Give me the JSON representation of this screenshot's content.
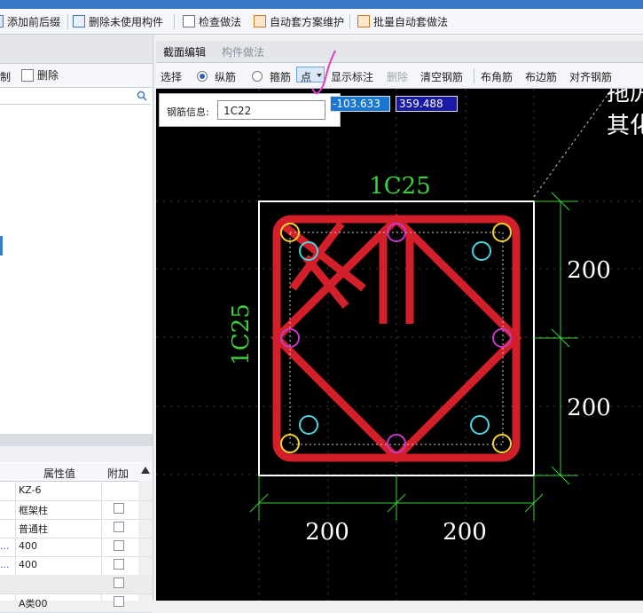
{
  "toolbar": {
    "add_affix": "添加前后缀",
    "delete_unused": "删除未使用构件",
    "check_method": "检查做法",
    "auto_scheme": "自动套方案维护",
    "batch_auto": "批量自动套做法"
  },
  "left_panel": {
    "copy_label": "制",
    "delete_label": "删除",
    "prop_headers": [
      "属性值",
      "附加"
    ],
    "rows": [
      {
        "prefix": "",
        "value": "KZ-6"
      },
      {
        "prefix": "",
        "value": "框架柱"
      },
      {
        "prefix": "",
        "value": "普通柱"
      },
      {
        "prefix": "...",
        "value": "400"
      },
      {
        "prefix": "...",
        "value": "400"
      },
      {
        "prefix": "",
        "value": ""
      },
      {
        "prefix": "",
        "value": "A类00"
      }
    ]
  },
  "tabs": {
    "section_edit": "截面编辑",
    "component_method": "构件做法"
  },
  "section_toolbar": {
    "select": "选择",
    "longitudinal": "纵筋",
    "stirrup": "箍筋",
    "point": "点",
    "show_label": "显示标注",
    "delete": "删除",
    "clear_rebar": "清空钢筋",
    "corner_rebar": "布角筋",
    "edge_rebar": "布边筋",
    "align_rebar": "对齐钢筋"
  },
  "rebar_info": {
    "label": "钢筋信息:",
    "value": "1C22"
  },
  "coords": {
    "x": "-103.633",
    "y": "359.488"
  },
  "drawing": {
    "top_label": "1C25",
    "side_label": "1C25",
    "dims": {
      "right_top": "200",
      "right_bottom": "200",
      "bottom_left": "200",
      "bottom_right": "200"
    },
    "partial_text": [
      "拖厉",
      "其化"
    ]
  },
  "colors": {
    "rebar": "#d21f2a",
    "dim": "#3cd13c",
    "corner_bar": "#f2d22e",
    "edge_bar": "#c838c8",
    "inner_bar": "#4bd5e0"
  }
}
